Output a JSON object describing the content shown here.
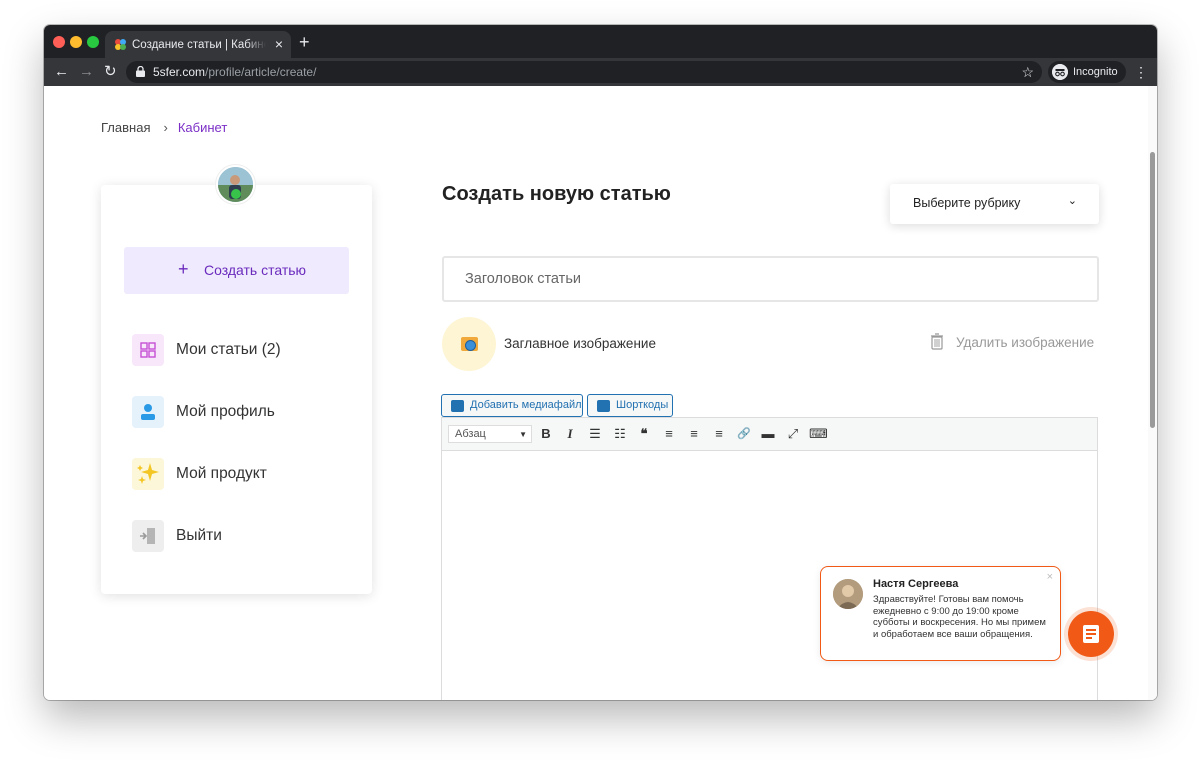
{
  "browser": {
    "tab_title": "Создание статьи | Кабинет автора",
    "tab_close": "×",
    "new_tab": "+",
    "url_host": "5sfer.com",
    "url_path": "/profile/article/create/",
    "incognito_label": "Incognito"
  },
  "breadcrumb": {
    "home": "Главная",
    "separator": "›",
    "current": "Кабинет"
  },
  "sidebar": {
    "create_plus": "+",
    "create_label": "Создать статью",
    "items": [
      {
        "label": "Мои статьи (2)",
        "icon": "articles-grid-icon"
      },
      {
        "label": "Мой профиль",
        "icon": "user-icon"
      },
      {
        "label": "Мой продукт",
        "icon": "sparkles-icon"
      },
      {
        "label": "Выйти",
        "icon": "logout-icon"
      }
    ]
  },
  "main": {
    "title": "Создать новую статью",
    "rubric_label": "Выберите рубрику",
    "rubric_chevron": "⌄",
    "title_placeholder": "Заголовок статьи",
    "cover_label": "Заглавное изображение",
    "delete_image_label": "Удалить изображение"
  },
  "editor": {
    "add_media_label": "Добавить медиафайл",
    "shortcodes_label": "Шорткоды",
    "format_value": "Абзац",
    "toolbar": [
      "B",
      "I",
      "☰",
      "☷",
      "❝",
      "≡",
      "≡",
      "≡",
      "🔗",
      "▬",
      "⤢",
      "⌨"
    ]
  },
  "chat": {
    "agent_name": "Настя Сергеева",
    "message": "Здравствуйте! Готовы вам помочь ежедневно с 9:00 до 19:00 кроме субботы и воскресения. Но мы примем и обработаем все ваши обращения.",
    "close": "×"
  },
  "colors": {
    "accent_purple": "#7b2fc7",
    "chat_orange": "#f05a16",
    "wp_blue": "#2271b1"
  }
}
